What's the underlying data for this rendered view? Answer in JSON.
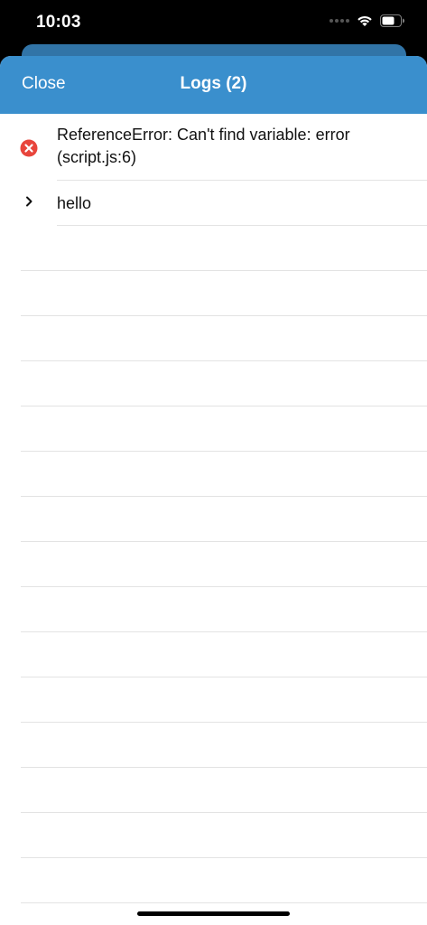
{
  "status_bar": {
    "time": "10:03"
  },
  "nav": {
    "close_label": "Close",
    "title": "Logs (2)"
  },
  "logs": [
    {
      "type": "error",
      "icon": "error-circle-icon",
      "text": "ReferenceError: Can't find variable: error (script.js:6)"
    },
    {
      "type": "log",
      "icon": "chevron-right-icon",
      "text": "hello"
    }
  ],
  "colors": {
    "nav_background": "#3a8fcd",
    "error_icon": "#e8453c"
  }
}
